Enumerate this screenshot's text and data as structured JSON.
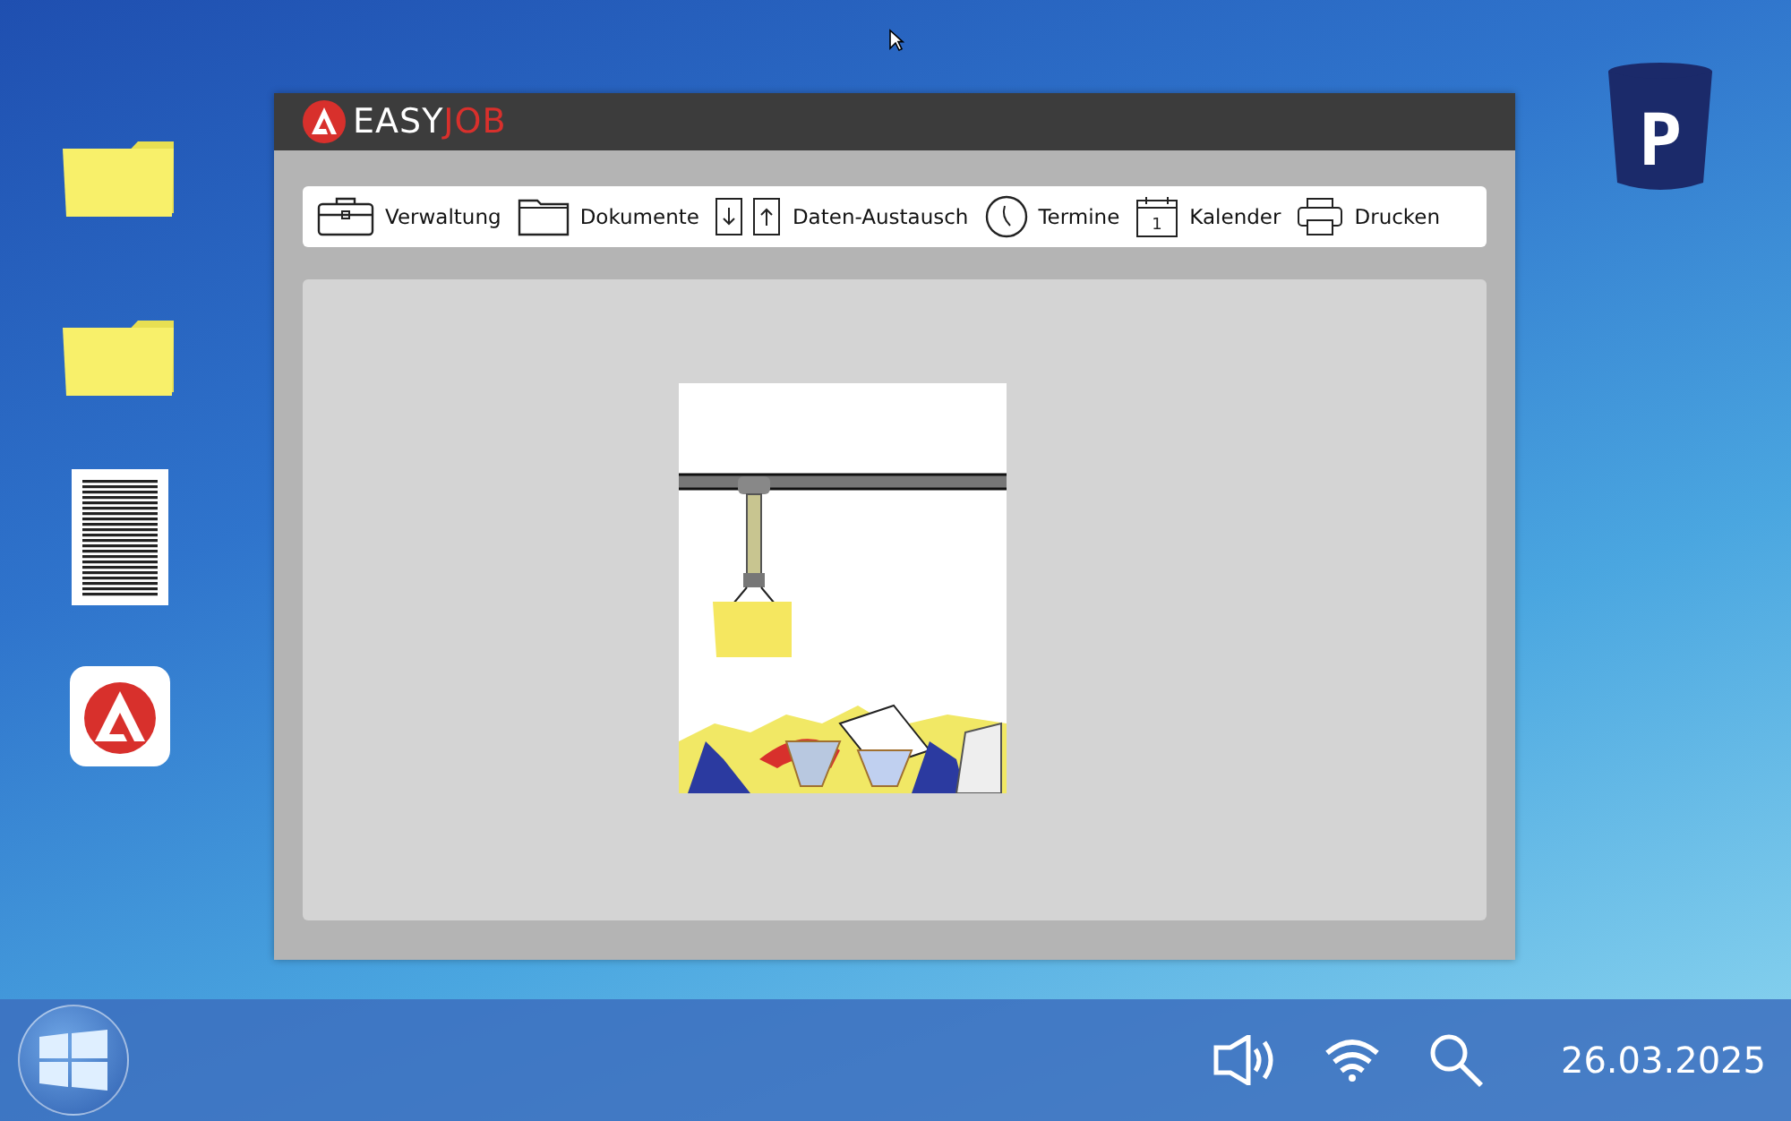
{
  "desktop_icons": [
    {
      "kind": "folder"
    },
    {
      "kind": "folder"
    },
    {
      "kind": "document"
    },
    {
      "kind": "app"
    }
  ],
  "recycle_bin": {
    "letter": "P"
  },
  "window": {
    "logo": {
      "first": "EASY",
      "second": "JOB"
    },
    "toolbar": [
      {
        "kind": "briefcase",
        "label": "Verwaltung"
      },
      {
        "kind": "folder",
        "label": "Dokumente"
      },
      {
        "kind": "exchange",
        "label": "Daten-Austausch"
      },
      {
        "kind": "clock",
        "label": "Termine"
      },
      {
        "kind": "calendar",
        "label": "Kalender",
        "day": "1"
      },
      {
        "kind": "printer",
        "label": "Drucken"
      }
    ]
  },
  "taskbar": {
    "date": "26.03.2025"
  }
}
